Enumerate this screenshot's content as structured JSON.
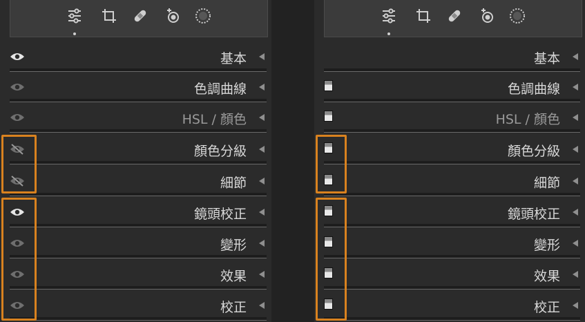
{
  "colors": {
    "panel_bg": "#2b2b2b",
    "toolbar_bg": "#3b3b3b",
    "highlight": "#d9821f",
    "text": "#d8d8d8"
  },
  "toolbar_icons": [
    "sliders-icon",
    "crop-icon",
    "healing-icon",
    "redeye-icon",
    "masking-icon"
  ],
  "left_panel": {
    "sections": [
      {
        "label": "基本",
        "visibility": "eye-on"
      },
      {
        "label": "色調曲線",
        "visibility": "eye-dim"
      },
      {
        "label": "HSL / 顏色",
        "visibility": "eye-dim"
      },
      {
        "label": "顏色分級",
        "visibility": "eye-off"
      },
      {
        "label": "細節",
        "visibility": "eye-off"
      },
      {
        "label": "鏡頭校正",
        "visibility": "eye-on"
      },
      {
        "label": "變形",
        "visibility": "eye-dim"
      },
      {
        "label": "效果",
        "visibility": "eye-dim"
      },
      {
        "label": "校正",
        "visibility": "eye-dim"
      }
    ]
  },
  "right_panel": {
    "sections": [
      {
        "label": "基本",
        "switch": "none"
      },
      {
        "label": "色調曲線",
        "switch": "toggle-switch"
      },
      {
        "label": "HSL / 顏色",
        "switch": "toggle-switch"
      },
      {
        "label": "顏色分級",
        "switch": "toggle-switch"
      },
      {
        "label": "細節",
        "switch": "toggle-switch"
      },
      {
        "label": "鏡頭校正",
        "switch": "toggle-switch"
      },
      {
        "label": "變形",
        "switch": "toggle-switch"
      },
      {
        "label": "效果",
        "switch": "toggle-switch"
      },
      {
        "label": "校正",
        "switch": "toggle-switch"
      }
    ]
  }
}
